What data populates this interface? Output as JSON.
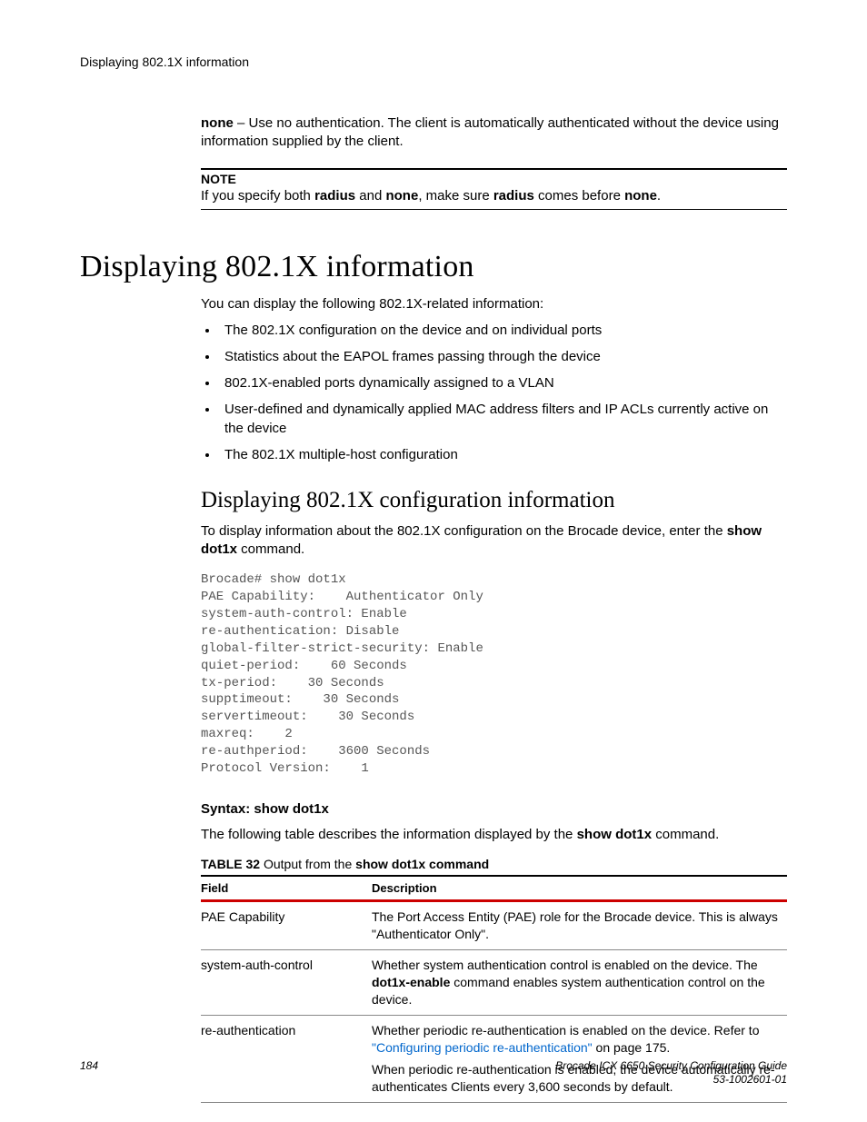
{
  "running_head": "Displaying 802.1X information",
  "intro_none": {
    "bold": "none",
    "rest": " – Use no authentication. The client is automatically authenticated without the device using information supplied by the client."
  },
  "note": {
    "label": "NOTE",
    "t1": "If you specify both ",
    "b1": "radius",
    "t2": " and ",
    "b2": "none",
    "t3": ", make sure ",
    "b3": "radius",
    "t4": " comes before ",
    "b4": "none",
    "t5": "."
  },
  "h1": "Displaying 802.1X information",
  "lead": "You can display the following 802.1X-related information:",
  "bullets": [
    "The 802.1X configuration on the device and on individual ports",
    "Statistics about the EAPOL frames passing through the device",
    "802.1X-enabled ports dynamically assigned to a VLAN",
    "User-defined and dynamically applied MAC address filters and IP ACLs currently active on the device",
    "The 802.1X multiple-host configuration"
  ],
  "h2": "Displaying 802.1X configuration information",
  "config_intro": {
    "t1": "To display information about the 802.1X configuration on the Brocade device, enter the ",
    "b1": "show dot1x",
    "t2": " command."
  },
  "code": "Brocade# show dot1x\nPAE Capability:    Authenticator Only\nsystem-auth-control: Enable\nre-authentication: Disable\nglobal-filter-strict-security: Enable\nquiet-period:    60 Seconds\ntx-period:    30 Seconds\nsupptimeout:    30 Seconds\nservertimeout:    30 Seconds\nmaxreq:    2\nre-authperiod:    3600 Seconds\nProtocol Version:    1",
  "syntax": {
    "label": "Syntax:  ",
    "cmd": "show dot1x"
  },
  "table_intro": {
    "t1": "The following table describes the information displayed by the ",
    "b1": "show dot1x",
    "t2": " command."
  },
  "table_caption": {
    "label": "TABLE 32",
    "gap": "        ",
    "t1": "Output from the ",
    "b1": "show dot1x command"
  },
  "table": {
    "headers": [
      "Field",
      "Description"
    ],
    "rows": [
      {
        "field": "PAE Capability",
        "desc": {
          "t1": "The Port Access Entity (PAE) role for the Brocade device. This is always \"Authenticator Only\"."
        }
      },
      {
        "field": "system-auth-control",
        "desc": {
          "t1": "Whether system authentication control is enabled on the device. The ",
          "b1": "dot1x-enable",
          "t2": " command enables system authentication control on the device."
        }
      },
      {
        "field": "re-authentication",
        "desc": {
          "t1": "Whether periodic re-authentication is enabled on the device. Refer to ",
          "link": "\"Configuring periodic re-authentication\"",
          "t2": " on page 175.",
          "para2": "When periodic re-authentication is enabled, the device automatically re-authenticates Clients every 3,600 seconds by default."
        }
      }
    ]
  },
  "footer": {
    "page": "184",
    "doc1": "Brocade ICX 6650 Security Configuration Guide",
    "doc2": "53-1002601-01"
  }
}
